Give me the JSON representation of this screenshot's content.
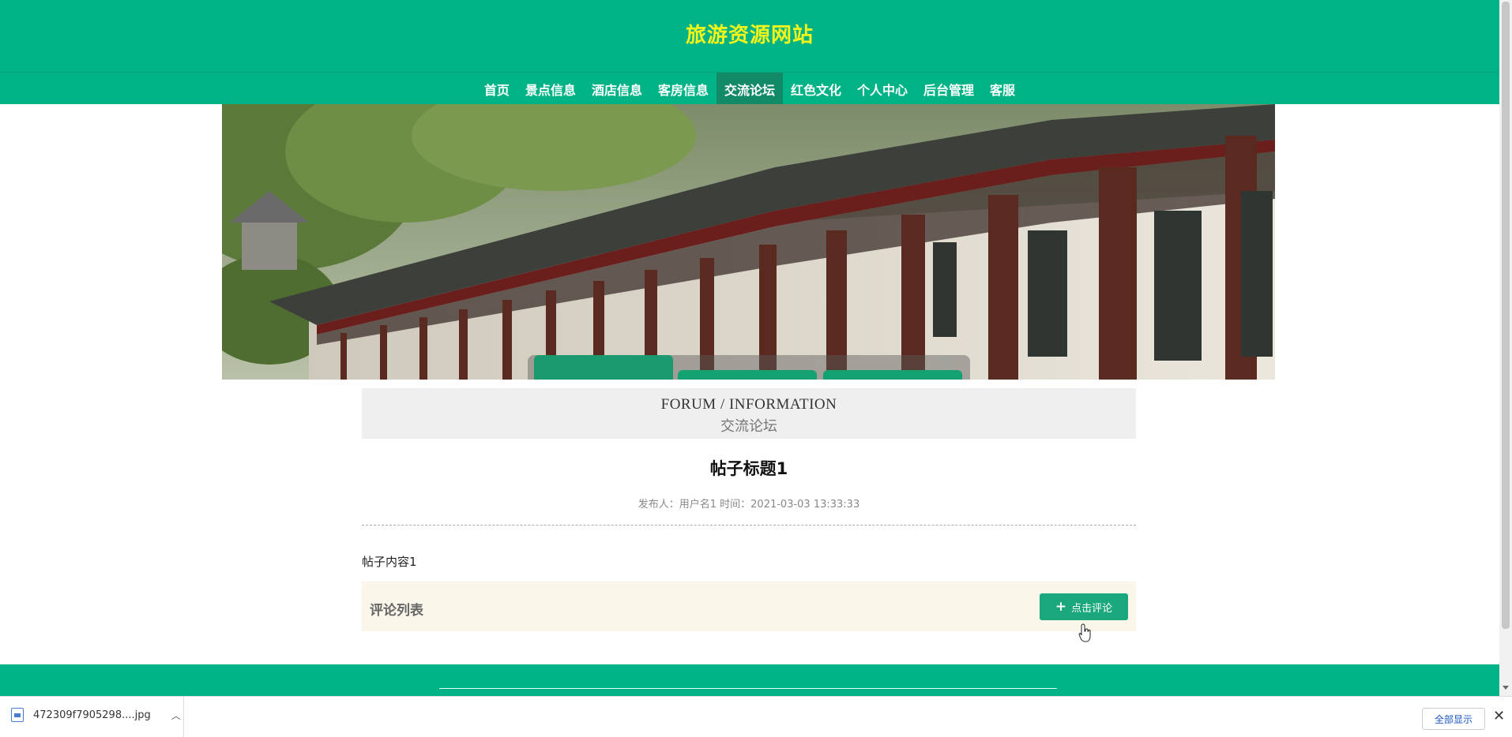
{
  "site": {
    "title": "旅游资源网站"
  },
  "nav": {
    "items": [
      {
        "label": "首页"
      },
      {
        "label": "景点信息"
      },
      {
        "label": "酒店信息"
      },
      {
        "label": "客房信息"
      },
      {
        "label": "交流论坛",
        "active": true
      },
      {
        "label": "红色文化"
      },
      {
        "label": "个人中心"
      },
      {
        "label": "后台管理"
      },
      {
        "label": "客服"
      }
    ]
  },
  "forum": {
    "title_en": "FORUM / INFORMATION",
    "title_cn": "交流论坛"
  },
  "post": {
    "title": "帖子标题1",
    "meta": "发布人：用户名1 时间：2021-03-03 13:33:33",
    "content": "帖子内容1"
  },
  "comments": {
    "label": "评论列表",
    "button_label": "点击评论"
  },
  "download_bar": {
    "file_name": "472309f7905298....jpg",
    "show_all": "全部显示"
  },
  "colors": {
    "primary": "#00b386",
    "title": "#f4f41a",
    "button": "#1aa77c",
    "comment_bg": "#faf6ea"
  }
}
